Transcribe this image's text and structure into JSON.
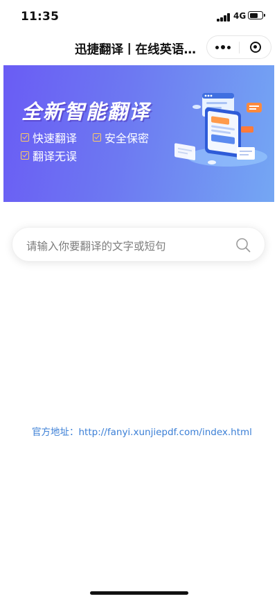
{
  "status_bar": {
    "time": "11:35",
    "network": "4G",
    "icons": [
      "signal-icon",
      "battery-icon"
    ]
  },
  "nav": {
    "title": "迅捷翻译丨在线英语翻译",
    "icons": [
      "more-icon",
      "close-miniprogram-icon"
    ]
  },
  "banner": {
    "title": "全新智能翻译",
    "features": [
      "快速翻译",
      "安全保密",
      "翻译无误"
    ],
    "colors": {
      "gradient_start": "#6a5cf4",
      "gradient_end": "#74a7f3",
      "check": "#ffcc63"
    }
  },
  "search": {
    "placeholder": "请输入你要翻译的文字或短句",
    "icon": "search-icon"
  },
  "footer": {
    "address_label": "官方地址：",
    "address_url": "http://fanyi.xunjiepdf.com/index.html",
    "link_color": "#3b7fd6"
  }
}
